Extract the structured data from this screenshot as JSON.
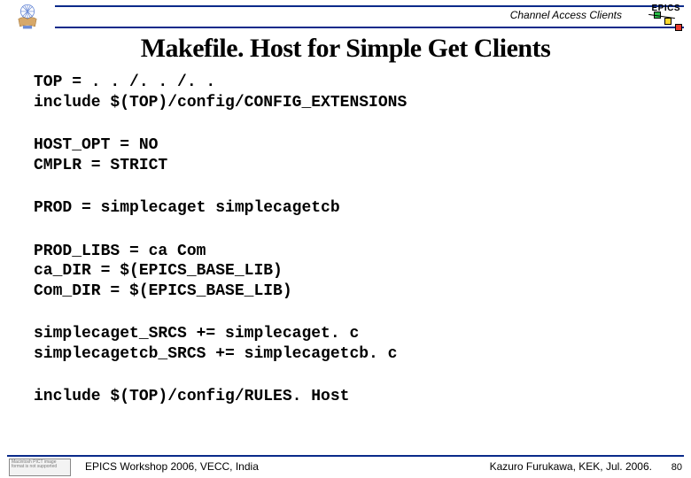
{
  "header": {
    "section_label": "Channel Access Clients",
    "epics_label": "EPICS"
  },
  "title": "Makefile. Host for Simple Get Clients",
  "code_blocks": [
    "TOP = . . /. . /. .\ninclude $(TOP)/config/CONFIG_EXTENSIONS",
    "HOST_OPT = NO\nCMPLR = STRICT",
    "PROD = simplecaget simplecagetcb",
    "PROD_LIBS = ca Com\nca_DIR = $(EPICS_BASE_LIB)\nCom_DIR = $(EPICS_BASE_LIB)",
    "simplecaget_SRCS += simplecaget. c\nsimplecagetcb_SRCS += simplecagetcb. c",
    "include $(TOP)/config/RULES. Host"
  ],
  "footer": {
    "left": "EPICS Workshop 2006, VECC, India",
    "right": "Kazuro Furukawa, KEK, Jul. 2006.",
    "page": "80",
    "broken_text": "Macintosh PICT image format is not supported"
  }
}
